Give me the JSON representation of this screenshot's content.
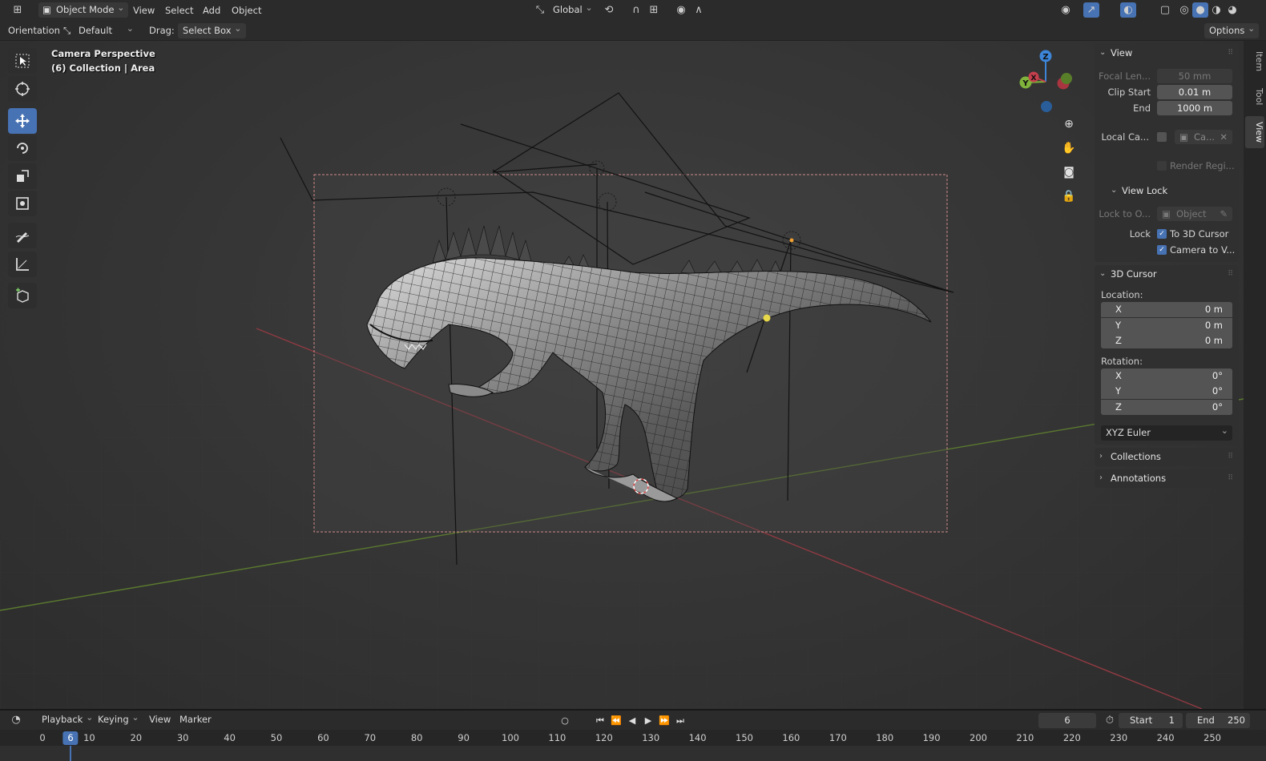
{
  "header": {
    "mode": "Object Mode",
    "menus": [
      "View",
      "Select",
      "Add",
      "Object"
    ],
    "transform_orientation": "Global"
  },
  "toolbar": {
    "orientation_label": "Orientation:",
    "orientation_value": "Default",
    "drag_label": "Drag:",
    "drag_value": "Select Box",
    "options_label": "Options"
  },
  "viewport": {
    "overlay_line1": "Camera Perspective",
    "overlay_line2": "(6) Collection | Area",
    "gizmo_axes": [
      "Z",
      "Y",
      "X"
    ]
  },
  "tools": [
    "select-box",
    "cursor",
    "move",
    "rotate",
    "scale",
    "transform",
    "annotate",
    "measure",
    "add-cube"
  ],
  "side_tabs": [
    "Item",
    "Tool",
    "View"
  ],
  "npanel": {
    "view": {
      "title": "View",
      "focal_label": "Focal Len...",
      "focal_value": "50 mm",
      "clip_start_label": "Clip Start",
      "clip_start_value": "0.01 m",
      "clip_end_label": "End",
      "clip_end_value": "1000 m",
      "local_camera_label": "Local Ca...",
      "local_camera_value": "Ca...",
      "render_region_label": "Render Regi..."
    },
    "view_lock": {
      "title": "View Lock",
      "lock_to_object_label": "Lock to O...",
      "lock_to_object_placeholder": "Object",
      "lock_label": "Lock",
      "to_3d_cursor": "To 3D Cursor",
      "camera_to_view": "Camera to V..."
    },
    "cursor": {
      "title": "3D Cursor",
      "location_label": "Location:",
      "location": [
        {
          "axis": "X",
          "value": "0 m"
        },
        {
          "axis": "Y",
          "value": "0 m"
        },
        {
          "axis": "Z",
          "value": "0 m"
        }
      ],
      "rotation_label": "Rotation:",
      "rotation": [
        {
          "axis": "X",
          "value": "0°"
        },
        {
          "axis": "Y",
          "value": "0°"
        },
        {
          "axis": "Z",
          "value": "0°"
        }
      ],
      "rotation_mode": "XYZ Euler"
    },
    "collections_title": "Collections",
    "annotations_title": "Annotations"
  },
  "timeline": {
    "menus": [
      "Playback",
      "Keying",
      "View",
      "Marker"
    ],
    "current_frame": "6",
    "start_label": "Start",
    "start_value": "1",
    "end_label": "End",
    "end_value": "250",
    "ruler": [
      "0",
      "6",
      "10",
      "20",
      "30",
      "40",
      "50",
      "60",
      "70",
      "80",
      "90",
      "100",
      "110",
      "120",
      "130",
      "140",
      "150",
      "160",
      "170",
      "180",
      "190",
      "200",
      "210",
      "220",
      "230",
      "240",
      "250"
    ]
  },
  "colors": {
    "accent": "#4772b3",
    "x_axis": "#c53f4d",
    "y_axis": "#7fb33b",
    "z_axis": "#3c85d8"
  }
}
